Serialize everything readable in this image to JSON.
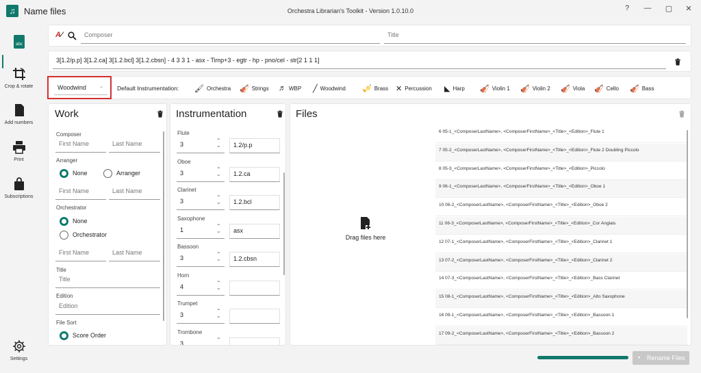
{
  "window": {
    "title": "Name files",
    "center_title": "Orchestra Librarian's Toolkit - Version 1.0.10.0",
    "help": "?",
    "minimize": "—",
    "maximize": "▢",
    "close": "✕"
  },
  "sidebar": {
    "items": [
      {
        "label": "",
        "icon": "abc-icon"
      },
      {
        "label": "Crop & rotate",
        "icon": "crop-rotate-icon"
      },
      {
        "label": "Add numbers",
        "icon": "document-icon"
      },
      {
        "label": "Print",
        "icon": "printer-icon"
      },
      {
        "label": "Subscriptions",
        "icon": "shopping-bag-icon"
      },
      {
        "label": "Settings",
        "icon": "gear-icon"
      }
    ],
    "abc_badge": "abc"
  },
  "search": {
    "composer_placeholder": "Composer",
    "title_placeholder": "Title"
  },
  "instrumentation_string": "3[1.2/p.p] 3[1.2.ca] 3[1.2.bcl] 3[1.2.cbsn] - 4 3 3 1 - asx - Timp+3 - egtr - hp - pno/cel - str[2 1 1 1]",
  "preset_dropdown": {
    "value": "Woodwind",
    "highlight_color": "#d32f2f"
  },
  "default_instrumentation": {
    "label": "Default Instrumentation:",
    "buttons": [
      "Orchestra",
      "Strings",
      "WBP",
      "Woodwind",
      "Brass",
      "Percussion",
      "Harp",
      "Violin 1",
      "Violin 2",
      "Viola",
      "Cello",
      "Bass"
    ]
  },
  "work": {
    "header": "Work",
    "composer_label": "Composer",
    "first_name_ph": "First Name",
    "last_name_ph": "Last Name",
    "arranger_label": "Arranger",
    "arranger_options": [
      "None",
      "Arranger"
    ],
    "orchestrator_label": "Orchestrator",
    "orchestrator_options": [
      "None",
      "Orchestrator"
    ],
    "title_label": "Title",
    "title_ph": "Title",
    "edition_label": "Edition",
    "edition_ph": "Edition",
    "file_sort_label": "File Sort",
    "file_sort_option": "Score Order"
  },
  "instrumentation": {
    "header": "Instrumentation",
    "rows": [
      {
        "name": "Flute",
        "count": "3",
        "detail": "1.2/p.p"
      },
      {
        "name": "Oboe",
        "count": "3",
        "detail": "1.2.ca"
      },
      {
        "name": "Clarinet",
        "count": "3",
        "detail": "1.2.bcl"
      },
      {
        "name": "Saxophone",
        "count": "1",
        "detail": "asx"
      },
      {
        "name": "Bassoon",
        "count": "3",
        "detail": "1.2.cbsn"
      },
      {
        "name": "Horn",
        "count": "4",
        "detail": ""
      },
      {
        "name": "Trumpet",
        "count": "3",
        "detail": ""
      },
      {
        "name": "Trombone",
        "count": "3",
        "detail": ""
      }
    ]
  },
  "files": {
    "header": "Files",
    "drag_text": "Drag files here",
    "list": [
      "6 05-1_<ComposerLastName>, <ComposerFirstName>_<Title>_<Edition>_Flute 1",
      "7 05-2_<ComposerLastName>, <ComposerFirstName>_<Title>_<Edition>_Flute 2 Doubling Piccolo",
      "8 05-3_<ComposerLastName>, <ComposerFirstName>_<Title>_<Edition>_Piccolo",
      "9 06-1_<ComposerLastName>, <ComposerFirstName>_<Title>_<Edition>_Oboe 1",
      "10 06-2_<ComposerLastName>, <ComposerFirstName>_<Title>_<Edition>_Oboe 2",
      "11 06-3_<ComposerLastName>, <ComposerFirstName>_<Title>_<Edition>_Cor Anglais",
      "12 07-1_<ComposerLastName>, <ComposerFirstName>_<Title>_<Edition>_Clarinet 1",
      "13 07-2_<ComposerLastName>, <ComposerFirstName>_<Title>_<Edition>_Clarinet 2",
      "14 07-3_<ComposerLastName>, <ComposerFirstName>_<Title>_<Edition>_Bass Clarinet",
      "15 08-1_<ComposerLastName>, <ComposerFirstName>_<Title>_<Edition>_Alto Saxophone",
      "16 09-1_<ComposerLastName>, <ComposerFirstName>_<Title>_<Edition>_Bassoon 1",
      "17 09-2_<ComposerLastName>, <ComposerFirstName>_<Title>_<Edition>_Bassoon 2"
    ]
  },
  "footer": {
    "rename_label": "Rename Files",
    "progress": 1.0,
    "accent": "#10796c"
  }
}
